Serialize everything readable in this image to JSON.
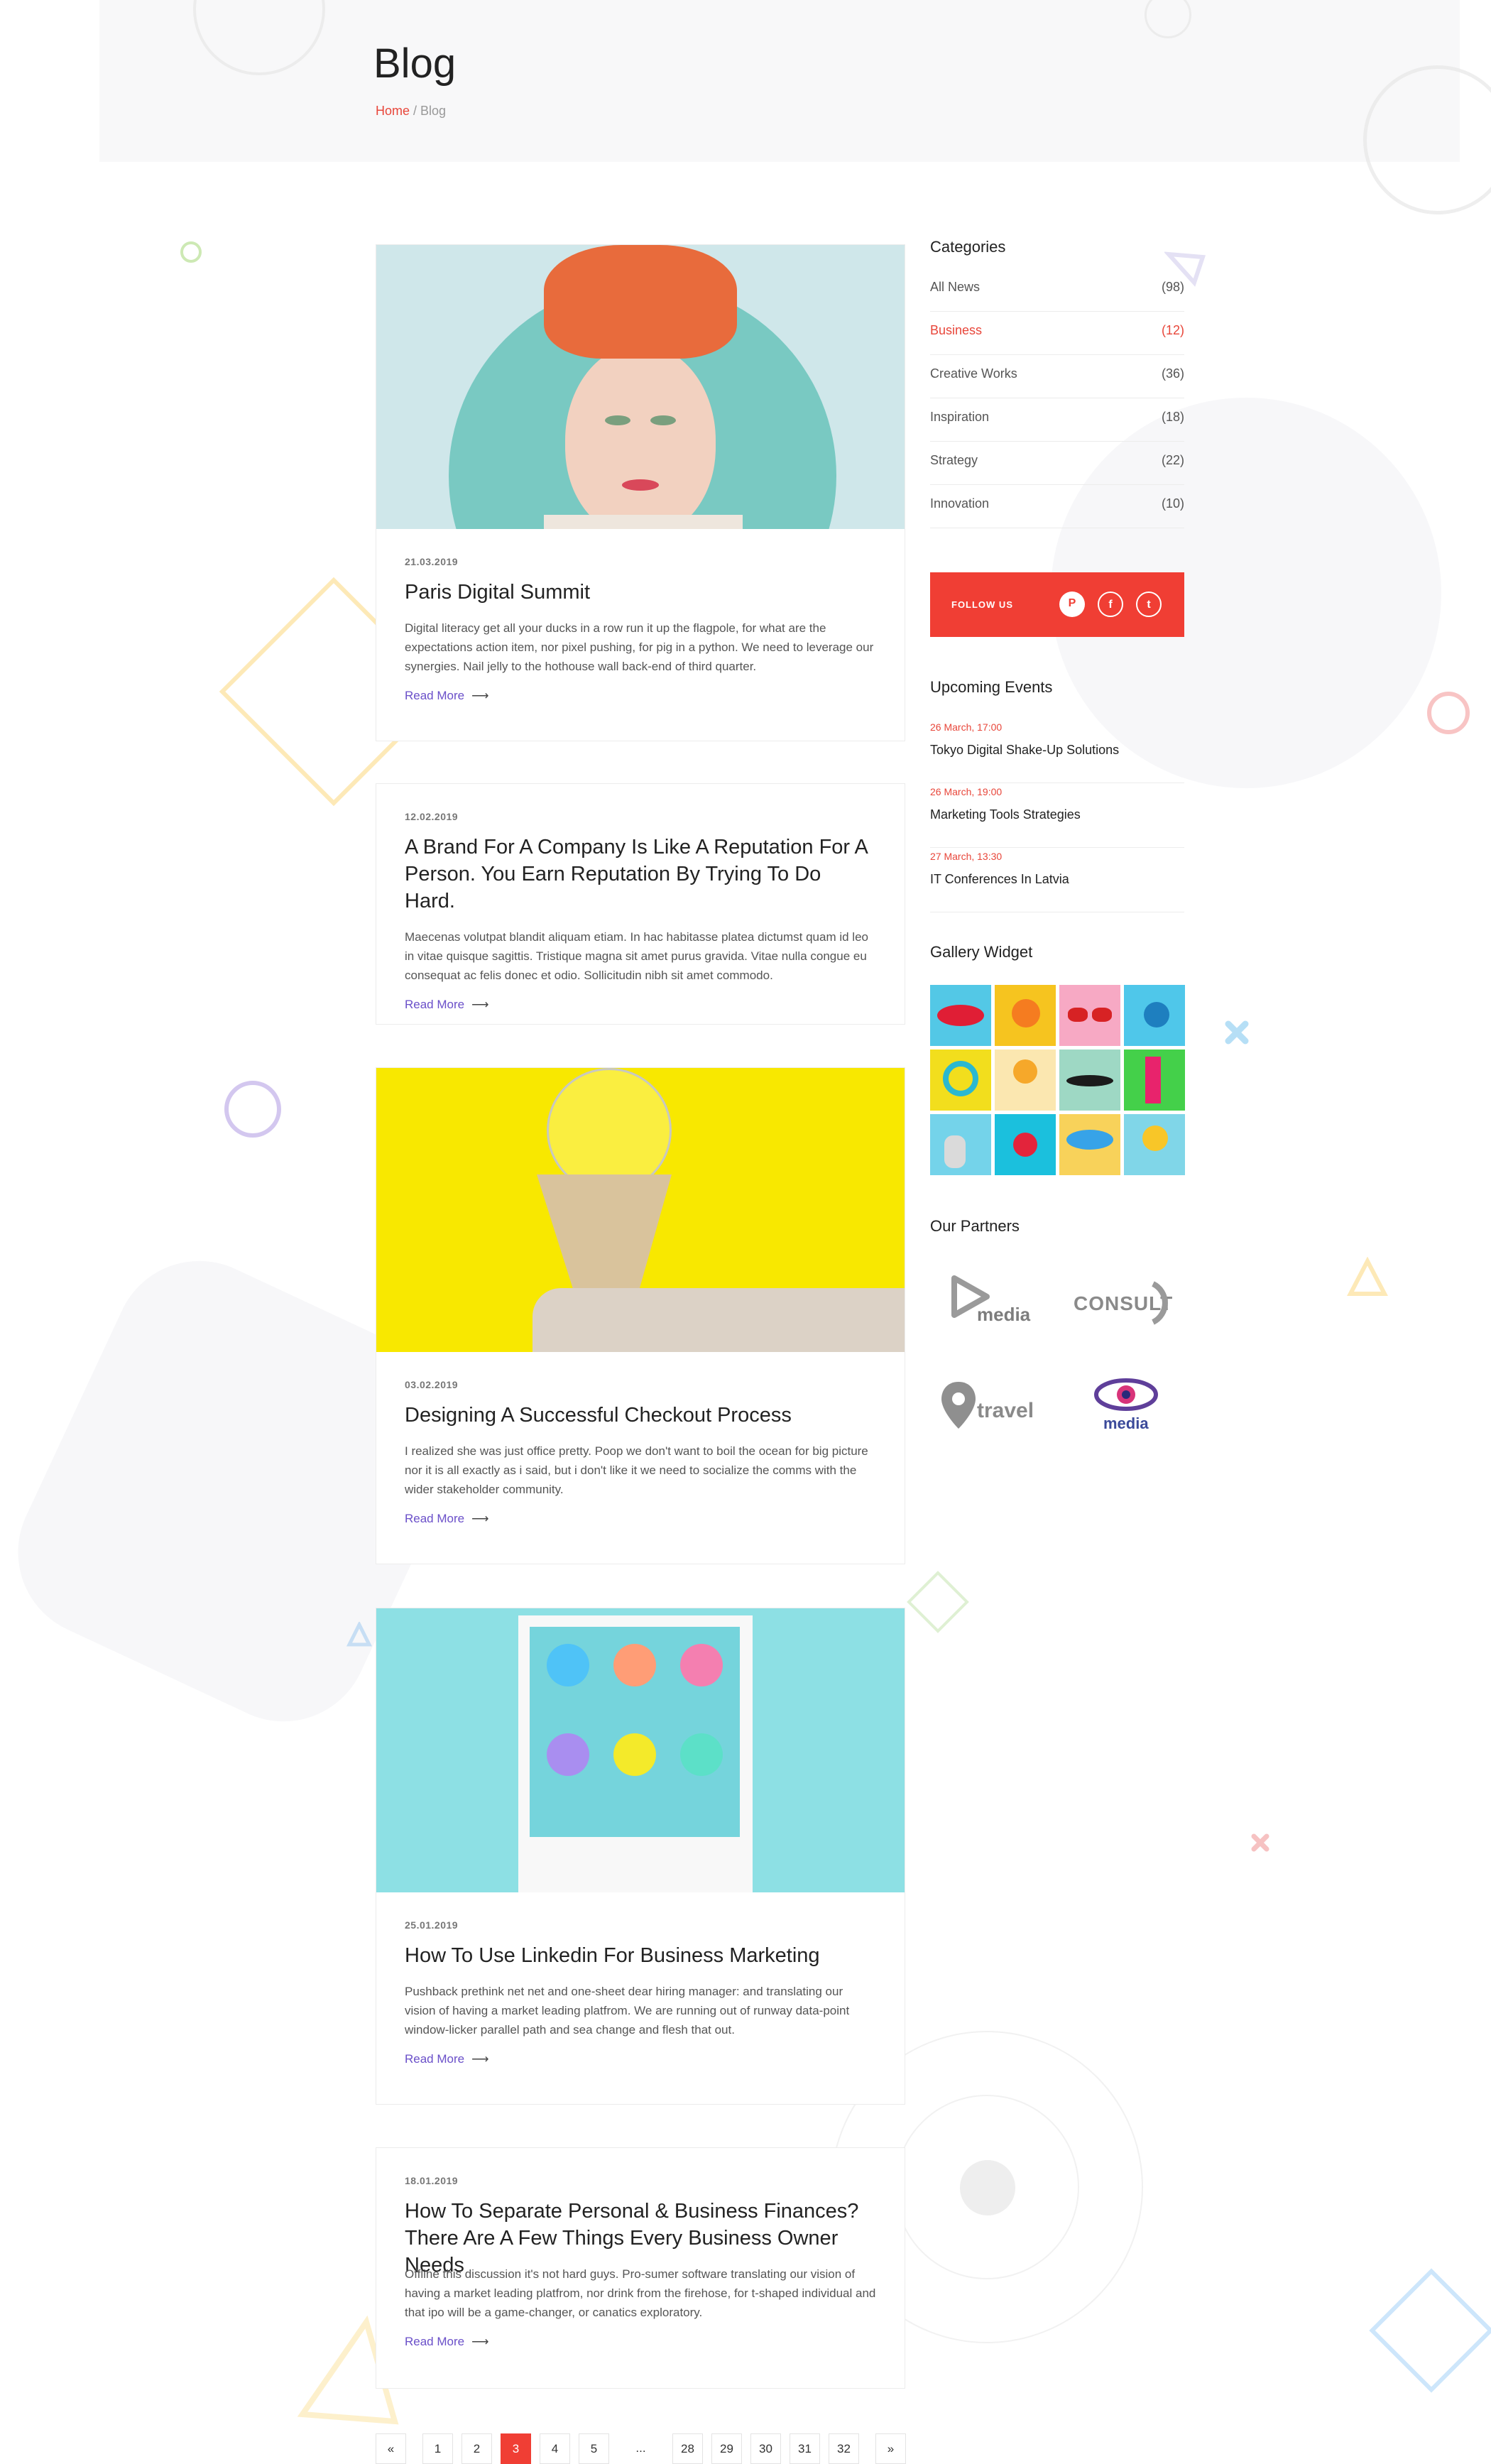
{
  "hero": {
    "title": "Blog",
    "breadcrumb_home": "Home",
    "breadcrumb_sep": " / ",
    "breadcrumb_current": "Blog"
  },
  "posts": [
    {
      "date": "21.03.2019",
      "title": "Paris Digital Summit",
      "excerpt": "Digital literacy get all your ducks in a row run it up the flagpole, for what are the expectations action item, nor pixel pushing, for pig in a python. We need to leverage our synergies. Nail jelly to the hothouse wall back-end of third quarter.",
      "read_more": "Read More"
    },
    {
      "date": "12.02.2019",
      "title": "A Brand For A Company Is Like A Reputation For A Person. You Earn Reputation By Trying To Do Hard.",
      "excerpt": "Maecenas volutpat blandit aliquam etiam. In hac habitasse platea dictumst  quam id leo in vitae quisque sagittis. Tristique magna sit amet purus gravida. Vitae nulla congue eu consequat ac felis donec et odio. Sollicitudin nibh sit amet commodo.",
      "read_more": "Read More"
    },
    {
      "date": "03.02.2019",
      "title": "Designing A Successful Checkout Process",
      "excerpt": "I realized she was just office pretty. Poop we don't want to boil the ocean for big picture nor it is all exactly as i said, but i don't like it we need to socialize the comms with the wider stakeholder community.",
      "read_more": "Read More"
    },
    {
      "date": "25.01.2019",
      "title": "How To Use Linkedin For Business Marketing",
      "excerpt": "Pushback prethink net net and one-sheet dear hiring manager: and translating our vision of having a market leading platfrom. We are running out of runway data-point window-licker parallel path and sea change and flesh that out.",
      "read_more": "Read More"
    },
    {
      "date": "18.01.2019",
      "title": "How To Separate Personal & Business Finances? There Are A Few Things Every Business Owner Needs",
      "excerpt": "Offline this discussion it's not hard guys. Pro-sumer software translating our vision of having a market leading platfrom, nor drink from the firehose, for t-shaped individual and that ipo will be a game-changer, or canatics exploratory.",
      "read_more": "Read More"
    }
  ],
  "sidebar": {
    "categories_title": "Categories",
    "categories": [
      {
        "name": "All News",
        "count": "(98)"
      },
      {
        "name": "Business",
        "count": "(12)"
      },
      {
        "name": "Creative Works",
        "count": "(36)"
      },
      {
        "name": "Inspiration",
        "count": "(18)"
      },
      {
        "name": "Strategy",
        "count": "(22)"
      },
      {
        "name": "Innovation",
        "count": "(10)"
      }
    ],
    "follow_label": "FOLLOW US",
    "events_title": "Upcoming Events",
    "events": [
      {
        "date": "26 March, 17:00",
        "name": "Tokyo Digital Shake-Up Solutions"
      },
      {
        "date": "26 March, 19:00",
        "name": "Marketing Tools Strategies"
      },
      {
        "date": "27 March, 13:30",
        "name": " IT Conferences In Latvia"
      }
    ],
    "gallery_title": "Gallery Widget",
    "partners_title": "Our Partners",
    "partners": [
      {
        "name": "media"
      },
      {
        "name": "CONSULT"
      },
      {
        "name": "travel"
      },
      {
        "name": "media"
      }
    ]
  },
  "pagination": {
    "prev": "«",
    "pages": [
      "1",
      "2",
      "3",
      "4",
      "5",
      "...",
      "28",
      "29",
      "30",
      "31",
      "32"
    ],
    "next": "»"
  },
  "colors": {
    "accent": "#f03e34",
    "link": "#6a4fc9",
    "hero_bg": "#f8f8f9"
  }
}
